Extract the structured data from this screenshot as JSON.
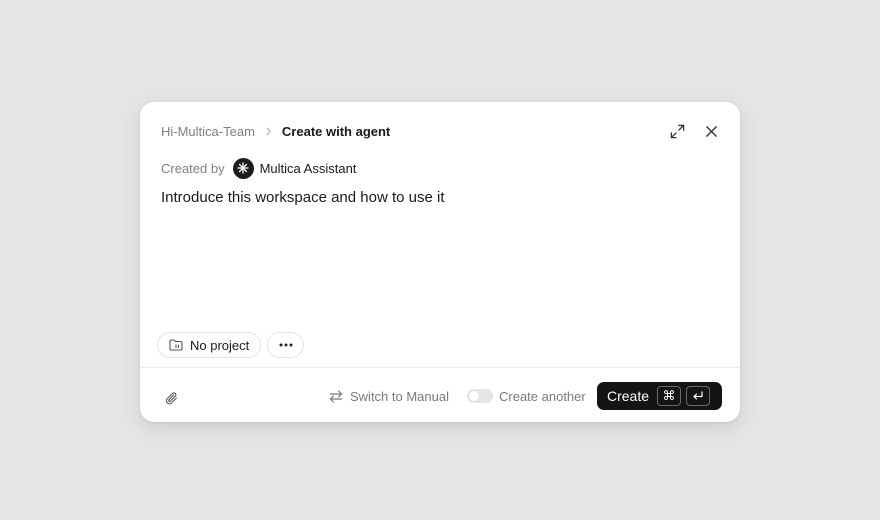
{
  "header": {
    "breadcrumb_parent": "Hi-Multica-Team",
    "breadcrumb_current": "Create with agent",
    "icons": {
      "separator": "chevron-right-icon",
      "expand": "expand-icon",
      "close": "close-icon"
    }
  },
  "meta": {
    "created_by_label": "Created by",
    "assistant_name": "Multica Assistant",
    "avatar_icon": "asterisk-icon"
  },
  "description": "Introduce this workspace and how to use it",
  "chips": {
    "project_label": "No project",
    "project_icon": "folder-icon",
    "more_icon": "ellipsis-icon"
  },
  "footer": {
    "attach_icon": "paperclip-icon",
    "switch_label": "Switch to Manual",
    "switch_icon": "swap-arrows-icon",
    "create_another_label": "Create another",
    "create_another_on": false,
    "create_label": "Create",
    "shortcut_cmd": "⌘",
    "shortcut_enter": "↵"
  },
  "colors": {
    "background": "#e5e5e5",
    "dialog": "#ffffff",
    "primary_button": "#141414",
    "muted_text": "#808080"
  }
}
